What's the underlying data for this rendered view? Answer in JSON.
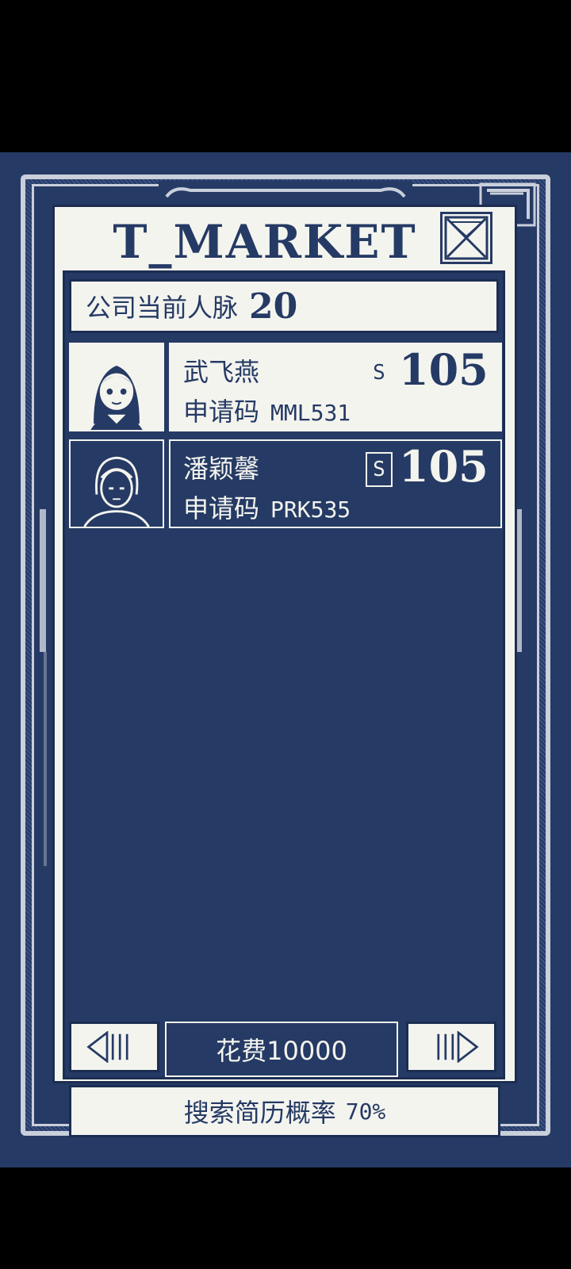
{
  "header": {
    "title": "T_MARKET"
  },
  "network": {
    "label": "公司当前人脉",
    "value": "20"
  },
  "candidates": [
    {
      "name": "武飞燕",
      "code_label": "申请码",
      "code": "MML531",
      "rank": "S",
      "score": "105"
    },
    {
      "name": "潘颖馨",
      "code_label": "申请码",
      "code": "PRK535",
      "rank": "S",
      "score": "105"
    }
  ],
  "footer": {
    "cost_label": "花费10000",
    "search_label": "搜索简历概率",
    "search_value": "70%"
  },
  "colors": {
    "background": "#253a64",
    "panel": "#f4f4ef",
    "accent": "#1c2d52"
  },
  "icons": {
    "close": "close-x-icon",
    "prev": "prev-arrow-icon",
    "next": "next-arrow-icon"
  }
}
